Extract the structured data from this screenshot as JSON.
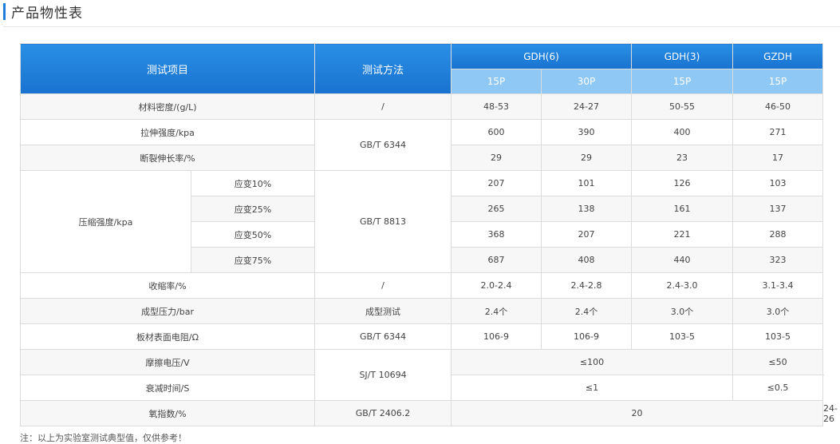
{
  "section_title": "产品物性表",
  "headers": {
    "test_item": "测试项目",
    "test_method": "测试方法",
    "groups": [
      "GDH(6)",
      "GDH(3)",
      "GZDH"
    ],
    "subs": [
      "15P",
      "30P",
      "15P",
      "15P"
    ]
  },
  "rows": {
    "density": {
      "label": "材料密度/(g/L)",
      "method": "/",
      "v": [
        "48-53",
        "24-27",
        "50-55",
        "46-50"
      ]
    },
    "tensile": {
      "label": "拉伸强度/kpa",
      "v": [
        "600",
        "390",
        "400",
        "271"
      ]
    },
    "elongation": {
      "label": "断裂伸长率/%",
      "v": [
        "29",
        "29",
        "23",
        "17"
      ]
    },
    "tens_method": "GB/T 6344",
    "compression": {
      "label": "压缩强度/kpa",
      "method": "GB/T 8813",
      "strains": [
        {
          "label": "应变10%",
          "v": [
            "207",
            "101",
            "126",
            "103"
          ]
        },
        {
          "label": "应变25%",
          "v": [
            "265",
            "138",
            "161",
            "137"
          ]
        },
        {
          "label": "应变50%",
          "v": [
            "368",
            "207",
            "221",
            "288"
          ]
        },
        {
          "label": "应变75%",
          "v": [
            "687",
            "408",
            "440",
            "323"
          ]
        }
      ]
    },
    "shrink": {
      "label": "收缩率/%",
      "method": "/",
      "v": [
        "2.0-2.4",
        "2.4-2.8",
        "2.4-3.0",
        "3.1-3.4"
      ]
    },
    "pressure": {
      "label": "成型压力/bar",
      "method": "成型测试",
      "v": [
        "2.4个",
        "2.4个",
        "3.0个",
        "3.0个"
      ]
    },
    "resistance": {
      "label": "板材表面电阻/Ω",
      "method": "GB/T 6344",
      "v": [
        "106-9",
        "106-9",
        "103-5",
        "103-5"
      ]
    },
    "friction": {
      "label": "摩擦电压/V",
      "v1": "≤100",
      "v2": "≤50"
    },
    "decay": {
      "label": "衰减时间/S",
      "v1": "≤1",
      "v2": "≤0.5"
    },
    "sj_method": "SJ/T 10694",
    "oxygen": {
      "label": "氧指数/%",
      "method": "GB/T 2406.2",
      "v1": "20",
      "v2": "24-26"
    }
  },
  "footnote": "注：以上为实验室测试典型值，仅供参考！"
}
